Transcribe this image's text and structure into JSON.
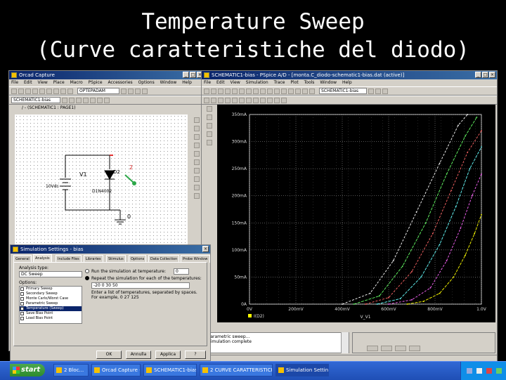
{
  "slide": {
    "title_line1": "Temperature Sweep",
    "title_line2": "(Curve caratteristiche del diodo)"
  },
  "capture": {
    "title": "Orcad Capture",
    "menu": [
      "File",
      "Edit",
      "View",
      "Place",
      "Macro",
      "PSpice",
      "Accessories",
      "Options",
      "Window",
      "Help"
    ],
    "part_combo": "OPTEPADAM",
    "profile_combo": "SCHEMATIC1-bias",
    "page_tab": "/ - (SCHEMATIC1 : PAGE1)",
    "schematic": {
      "source_ref": "V1",
      "source_value": "10Vdc",
      "diode_ref": "D2",
      "diode_part": "D1N4002",
      "net_label": "2",
      "ground_label": "0"
    }
  },
  "pspice": {
    "title": "SCHEMATIC1-bias - PSpice A/D - [monta.C_diodo-schematic1-bias.dat (active)]",
    "menu": [
      "File",
      "Edit",
      "View",
      "Simulation",
      "Trace",
      "Plot",
      "Tools",
      "Window",
      "Help"
    ],
    "profile_combo": "SCHEMATIC1-bias",
    "trace_label": "I(D2)",
    "x_axis_name": "V_V1",
    "output_lines": [
      "Parametric sweep...",
      "Simulation complete"
    ],
    "chart_data": {
      "type": "line",
      "title": "",
      "xlabel": "V_V1",
      "ylabel": "",
      "y_tick_labels": [
        "0A",
        "50mA",
        "100mA",
        "150mA",
        "200mA",
        "250mA",
        "300mA",
        "350mA"
      ],
      "x_tick_labels": [
        "0V",
        "200mV",
        "400mV",
        "600mV",
        "800mV",
        "1.0V"
      ],
      "xlim": [
        0,
        1.0
      ],
      "ylim": [
        0,
        0.35
      ],
      "grid": true,
      "legend": "I(D2)",
      "series": [
        {
          "color": "#ffff00",
          "values": [
            [
              0.68,
              0.0
            ],
            [
              0.75,
              0.005
            ],
            [
              0.82,
              0.02
            ],
            [
              0.88,
              0.05
            ],
            [
              0.93,
              0.09
            ],
            [
              0.97,
              0.13
            ],
            [
              1.0,
              0.165
            ]
          ]
        },
        {
          "color": "#ff66ff",
          "values": [
            [
              0.6,
              0.0
            ],
            [
              0.7,
              0.008
            ],
            [
              0.78,
              0.03
            ],
            [
              0.85,
              0.08
            ],
            [
              0.91,
              0.14
            ],
            [
              0.96,
              0.2
            ],
            [
              1.0,
              0.24
            ]
          ]
        },
        {
          "color": "#66ffff",
          "values": [
            [
              0.55,
              0.0
            ],
            [
              0.65,
              0.01
            ],
            [
              0.74,
              0.05
            ],
            [
              0.82,
              0.11
            ],
            [
              0.89,
              0.18
            ],
            [
              0.95,
              0.25
            ],
            [
              1.0,
              0.29
            ]
          ]
        },
        {
          "color": "#ff6666",
          "values": [
            [
              0.5,
              0.0
            ],
            [
              0.6,
              0.012
            ],
            [
              0.7,
              0.06
            ],
            [
              0.79,
              0.13
            ],
            [
              0.87,
              0.21
            ],
            [
              0.94,
              0.28
            ],
            [
              1.0,
              0.32
            ]
          ]
        },
        {
          "color": "#66ff66",
          "values": [
            [
              0.45,
              0.0
            ],
            [
              0.56,
              0.015
            ],
            [
              0.66,
              0.07
            ],
            [
              0.76,
              0.15
            ],
            [
              0.85,
              0.24
            ],
            [
              0.93,
              0.31
            ],
            [
              0.98,
              0.345
            ]
          ]
        },
        {
          "color": "#ffffff",
          "values": [
            [
              0.4,
              0.0
            ],
            [
              0.52,
              0.02
            ],
            [
              0.62,
              0.08
            ],
            [
              0.72,
              0.17
            ],
            [
              0.82,
              0.26
            ],
            [
              0.9,
              0.33
            ],
            [
              0.94,
              0.35
            ]
          ]
        }
      ]
    }
  },
  "sim_dialog": {
    "title": "Simulation Settings - bias",
    "tabs": [
      "General",
      "Analysis",
      "Include Files",
      "Libraries",
      "Stimulus",
      "Options",
      "Data Collection",
      "Probe Window"
    ],
    "analysis_type_label": "Analysis type:",
    "analysis_type_value": "DC Sweep",
    "options_label": "Options:",
    "options": [
      {
        "label": "Primary Sweep",
        "checked": true,
        "selected": false
      },
      {
        "label": "Secondary Sweep",
        "checked": false,
        "selected": false
      },
      {
        "label": "Monte Carlo/Worst Case",
        "checked": false,
        "selected": false
      },
      {
        "label": "Parametric Sweep",
        "checked": false,
        "selected": false
      },
      {
        "label": "Temperature (Sweep)",
        "checked": true,
        "selected": true
      },
      {
        "label": "Save Bias Point",
        "checked": false,
        "selected": false
      },
      {
        "label": "Load Bias Point",
        "checked": false,
        "selected": false
      }
    ],
    "radio1": "Run the simulation at temperature:",
    "radio1_value": "0",
    "radio2": "Repeat the simulation for each of the temperatures:",
    "radio2_value": "-20 0 30 50",
    "note": "Enter a list of temperatures, separated by spaces. For example, 0 27 125",
    "ok": "OK",
    "cancel": "Annulla",
    "apply": "Applica",
    "help": "?"
  },
  "taskbar": {
    "start": "start",
    "items": [
      "2 Bloc...",
      "Orcad Capture - ...",
      "SCHEMATIC1-bias...",
      "2 CURVE CARATTERISTICHE...",
      "Simulation Settin..."
    ]
  }
}
